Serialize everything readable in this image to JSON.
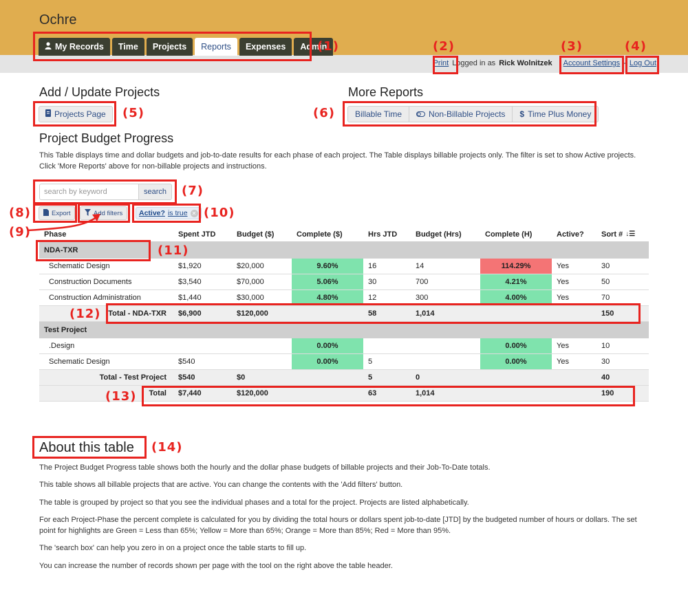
{
  "app": {
    "name": "Ochre"
  },
  "nav": {
    "tabs": [
      {
        "label": "My Records",
        "icon": "person-icon"
      },
      {
        "label": "Time"
      },
      {
        "label": "Projects"
      },
      {
        "label": "Reports",
        "active": true
      },
      {
        "label": "Expenses"
      },
      {
        "label": "Admin"
      }
    ]
  },
  "toplinks": {
    "print": "Print",
    "logged_in_as": "Logged in as",
    "user": "Rick Wolnitzek",
    "account_settings": "Account Settings",
    "separator": "-",
    "logout": "Log Out"
  },
  "add_update": {
    "heading": "Add / Update Projects",
    "projects_button": "Projects Page"
  },
  "more_reports": {
    "heading": "More Reports",
    "buttons": [
      "Billable Time",
      "Non-Billable Projects",
      "Time Plus Money"
    ]
  },
  "budget": {
    "heading": "Project Budget Progress",
    "description": "This Table displays time and dollar budgets and job-to-date results for each phase of each project. The Table displays billable projects only. The filter is set to show Active projects. Click 'More Reports' above for non-billable projects and instructions."
  },
  "search": {
    "placeholder": "search by keyword",
    "button": "search"
  },
  "tools": {
    "export": "Export",
    "add_filters": "Add filters"
  },
  "filter_chip": {
    "field": "Active?",
    "value": "is true"
  },
  "table": {
    "columns": [
      "Phase",
      "Spent JTD",
      "Budget ($)",
      "Complete ($)",
      "Hrs JTD",
      "Budget (Hrs)",
      "Complete (H)",
      "Active?",
      "Sort #"
    ],
    "groups": [
      {
        "name": "NDA-TXR",
        "rows": [
          {
            "phase": "Schematic Design",
            "spent": "$1,920",
            "budget": "$20,000",
            "complete_d": "9.60%",
            "hrs": "16",
            "budget_h": "14",
            "complete_h": "114.29%",
            "active": "Yes",
            "sort": "30"
          },
          {
            "phase": "Construction Documents",
            "spent": "$3,540",
            "budget": "$70,000",
            "complete_d": "5.06%",
            "hrs": "30",
            "budget_h": "700",
            "complete_h": "4.21%",
            "active": "Yes",
            "sort": "50"
          },
          {
            "phase": "Construction Administration",
            "spent": "$1,440",
            "budget": "$30,000",
            "complete_d": "4.80%",
            "hrs": "12",
            "budget_h": "300",
            "complete_h": "4.00%",
            "active": "Yes",
            "sort": "70"
          }
        ],
        "total": {
          "label": "Total - NDA-TXR",
          "spent": "$6,900",
          "budget": "$120,000",
          "hrs": "58",
          "budget_h": "1,014",
          "sort": "150"
        }
      },
      {
        "name": "Test Project",
        "rows": [
          {
            "phase": ".Design",
            "spent": "",
            "budget": "",
            "complete_d": "0.00%",
            "hrs": "",
            "budget_h": "",
            "complete_h": "0.00%",
            "active": "Yes",
            "sort": "10"
          },
          {
            "phase": "Schematic Design",
            "spent": "$540",
            "budget": "",
            "complete_d": "0.00%",
            "hrs": "5",
            "budget_h": "",
            "complete_h": "0.00%",
            "active": "Yes",
            "sort": "30"
          }
        ],
        "total": {
          "label": "Total - Test Project",
          "spent": "$540",
          "budget": "$0",
          "hrs": "5",
          "budget_h": "0",
          "sort": "40"
        }
      }
    ],
    "grand_total": {
      "label": "Total",
      "spent": "$7,440",
      "budget": "$120,000",
      "hrs": "63",
      "budget_h": "1,014",
      "sort": "190"
    }
  },
  "about": {
    "heading": "About this table",
    "paragraphs": [
      "The Project Budget Progress table shows both the hourly and the dollar phase budgets of billable projects and their Job-To-Date totals.",
      "This table shows all billable projects that are active. You can change the contents with the 'Add filters' button.",
      "The table is grouped by project so that you see the individual phases and a total for the project. Projects are listed alphabetically.",
      "For each Project-Phase the percent complete is calculated for you by dividing the total hours or dollars spent job-to-date [JTD] by the budgeted number of hours or dollars. The set point for highlights are Green = Less than 65%; Yellow = More than 65%; Orange = More than 85%; Red = More than 95%.",
      "The 'search box' can help you zero in on a project once the table starts to fill up.",
      "You can increase the number of records shown per page with the tool on the right above the table header."
    ]
  },
  "annotations": [
    "(1)",
    "(2)",
    "(3)",
    "(4)",
    "(5)",
    "(6)",
    "(7)",
    "(8)",
    "(9)",
    "(10)",
    "(11)",
    "(12)",
    "(13)",
    "(14)"
  ],
  "colors": {
    "header": "#e0ad4f",
    "nav_tab": "#3b3f31",
    "link": "#1f4a8a",
    "green": "#7fe3ad",
    "red": "#f47475",
    "annotation": "#e8231f"
  }
}
